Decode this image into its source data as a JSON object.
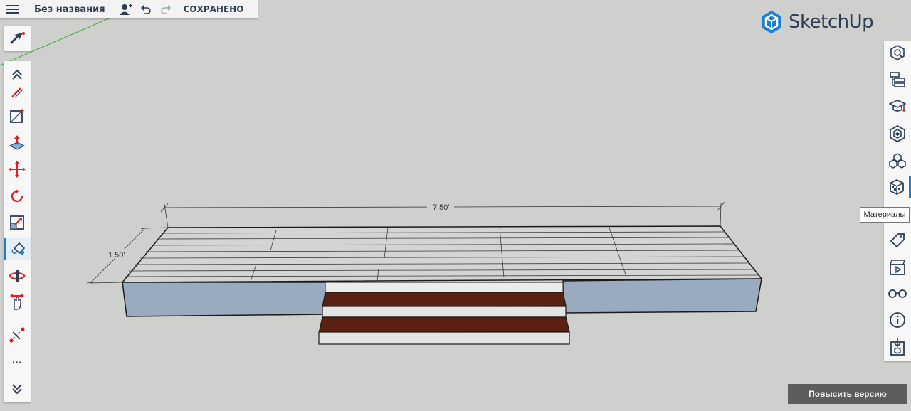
{
  "app": {
    "logo_text": "SketchUp"
  },
  "topbar": {
    "title": "Без названия",
    "saved_label": "СОХРАНЕНО",
    "icons": [
      "menu-icon",
      "add-user-icon",
      "undo-icon",
      "redo-icon"
    ]
  },
  "left_toolbar": {
    "select_tool": "select-arrow-icon",
    "tools": [
      "expand-up-icon",
      "pencil-icon",
      "rectangle-icon",
      "push-pull-icon",
      "move-icon",
      "rotate-icon",
      "scale-icon",
      "paint-bucket-icon",
      "orbit-icon",
      "pan-icon",
      "tape-measure-icon",
      "more-icon",
      "expand-down-icon"
    ],
    "active_tool": "paint-bucket-icon",
    "more_label": "···"
  },
  "right_panel": {
    "tools": [
      "entity-info-icon",
      "outliner-icon",
      "instructor-icon",
      "components-icon",
      "solids-icon",
      "materials-icon",
      "styles-icon",
      "tags-icon",
      "scenes-icon",
      "display-icon",
      "info-icon",
      "export-icon"
    ],
    "active_tool": "materials-icon",
    "tooltip": "Материалы"
  },
  "model": {
    "dimension_length": "7.50'",
    "dimension_width": "1.50'",
    "colors": {
      "deck_top": "#d4d4d4",
      "deck_side": "#9aabbf",
      "step_tread": "#5a2012",
      "step_riser": "#e4e4e4",
      "edge": "#1a1a1a"
    }
  },
  "footer": {
    "upgrade_button": "Повысить версию"
  }
}
